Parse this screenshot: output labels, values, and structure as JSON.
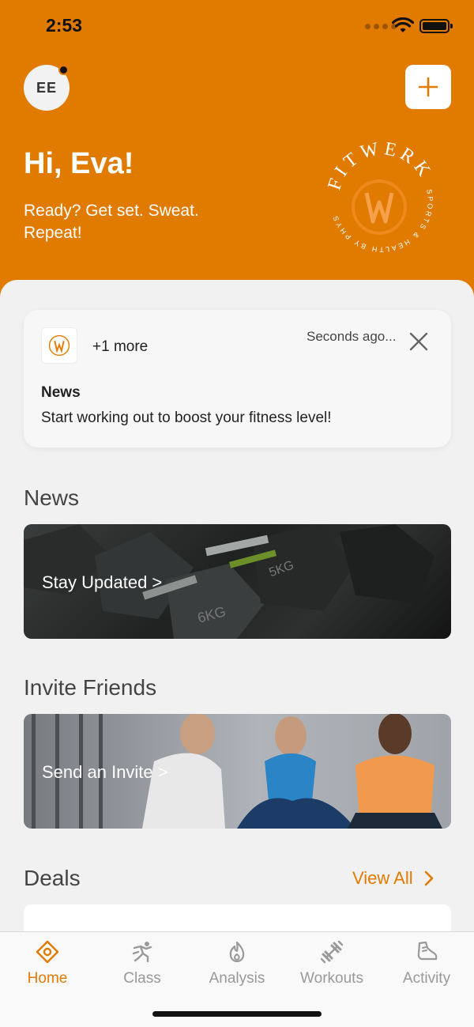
{
  "status_bar": {
    "time": "2:53"
  },
  "header": {
    "avatar_initials": "EE",
    "greeting": "Hi, Eva!",
    "subtitle": "Ready? Get set. Sweat. Repeat!",
    "logo_text": "FITWERK",
    "logo_ring_text": "SPORTS & HEALTH BY PHYSIOFIT",
    "accent_color": "#e17b00"
  },
  "notification": {
    "more_text": "+1 more",
    "time": "Seconds ago...",
    "title": "News",
    "body": "Start working out to boost your fitness level!"
  },
  "sections": {
    "news": {
      "title": "News",
      "banner_label": "Stay Updated >"
    },
    "invite": {
      "title": "Invite Friends",
      "banner_label": "Send an Invite >"
    },
    "deals": {
      "title": "Deals",
      "view_all": "View All"
    }
  },
  "tabs": [
    {
      "label": "Home",
      "icon": "home-icon",
      "active": true
    },
    {
      "label": "Class",
      "icon": "class-icon",
      "active": false
    },
    {
      "label": "Analysis",
      "icon": "flame-icon",
      "active": false
    },
    {
      "label": "Workouts",
      "icon": "dumbbell-icon",
      "active": false
    },
    {
      "label": "Activity",
      "icon": "shoe-icon",
      "active": false
    }
  ]
}
